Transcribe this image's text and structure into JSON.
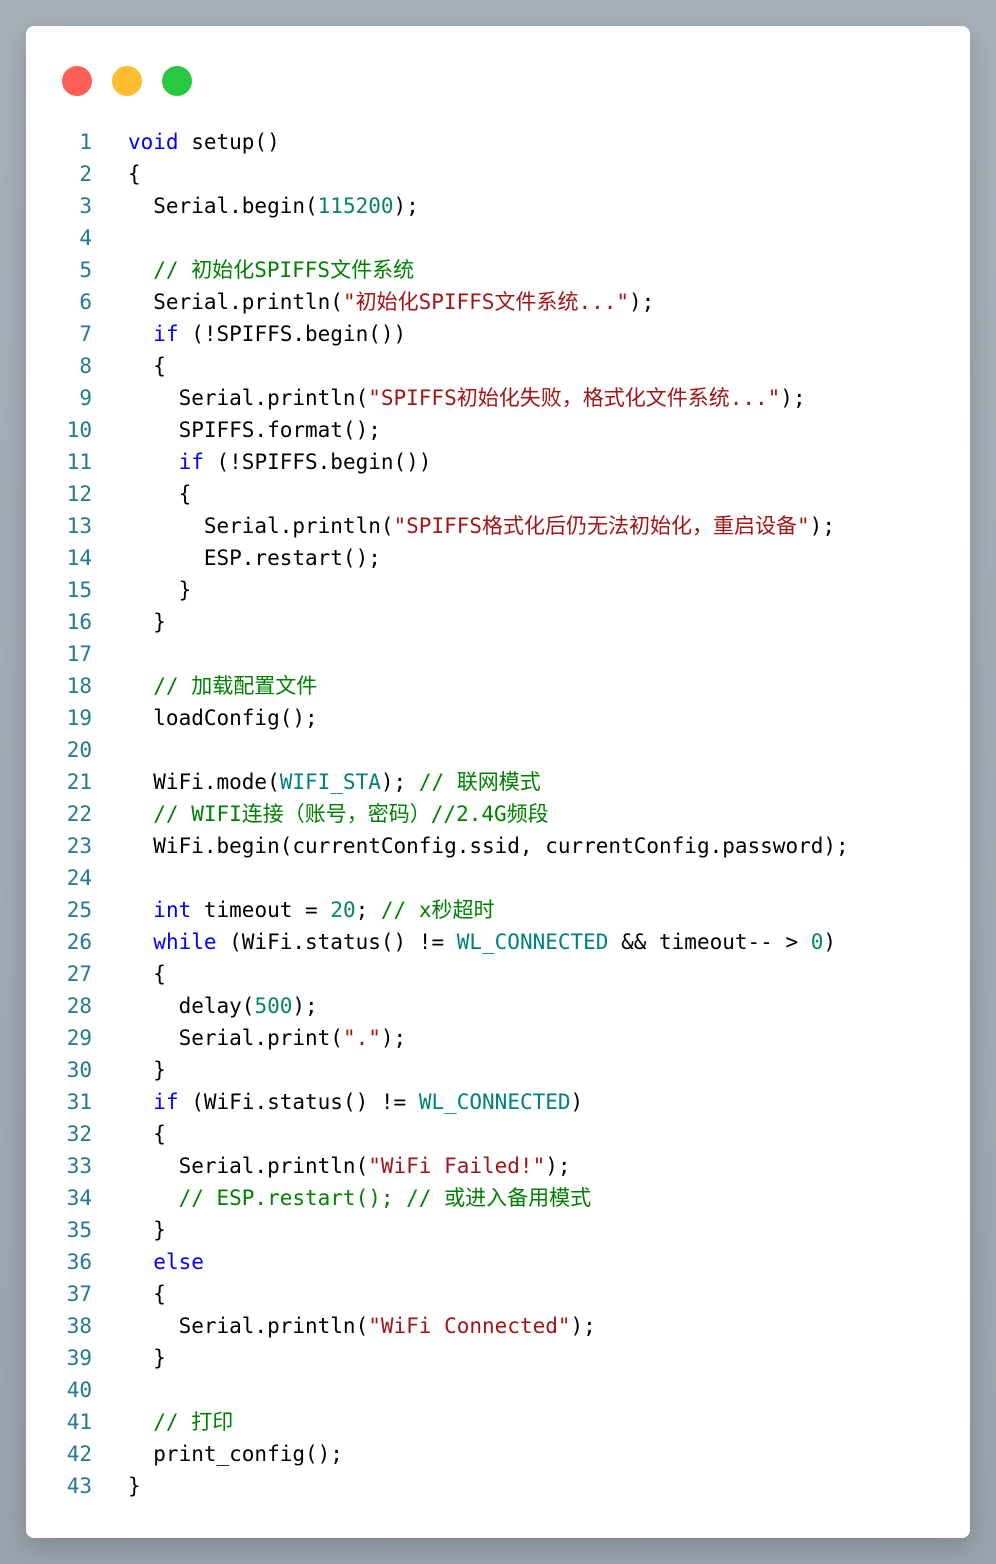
{
  "window": {
    "buttons": [
      {
        "name": "close",
        "color": "#ff5f57"
      },
      {
        "name": "minimize",
        "color": "#febc2e"
      },
      {
        "name": "zoom",
        "color": "#28c840"
      }
    ]
  },
  "colors": {
    "keyword": "#0000ff",
    "number": "#098658",
    "string": "#a31515",
    "comment": "#008000",
    "constant": "#008080",
    "line_number": "#237893"
  },
  "code": {
    "lines": [
      {
        "n": "1",
        "tokens": [
          {
            "t": "kw",
            "v": "void"
          },
          {
            "t": "plain",
            "v": " setup()"
          }
        ]
      },
      {
        "n": "2",
        "tokens": [
          {
            "t": "plain",
            "v": "{"
          }
        ]
      },
      {
        "n": "3",
        "tokens": [
          {
            "t": "plain",
            "v": "  Serial.begin("
          },
          {
            "t": "num",
            "v": "115200"
          },
          {
            "t": "plain",
            "v": ");"
          }
        ]
      },
      {
        "n": "4",
        "tokens": []
      },
      {
        "n": "5",
        "tokens": [
          {
            "t": "cmt",
            "v": "  // 初始化SPIFFS文件系统"
          }
        ]
      },
      {
        "n": "6",
        "tokens": [
          {
            "t": "plain",
            "v": "  Serial.println("
          },
          {
            "t": "str",
            "v": "\"初始化SPIFFS文件系统...\""
          },
          {
            "t": "plain",
            "v": ");"
          }
        ]
      },
      {
        "n": "7",
        "tokens": [
          {
            "t": "plain",
            "v": "  "
          },
          {
            "t": "kw",
            "v": "if"
          },
          {
            "t": "plain",
            "v": " (!SPIFFS.begin())"
          }
        ]
      },
      {
        "n": "8",
        "tokens": [
          {
            "t": "plain",
            "v": "  {"
          }
        ]
      },
      {
        "n": "9",
        "tokens": [
          {
            "t": "plain",
            "v": "    Serial.println("
          },
          {
            "t": "str",
            "v": "\"SPIFFS初始化失败，格式化文件系统...\""
          },
          {
            "t": "plain",
            "v": ");"
          }
        ]
      },
      {
        "n": "10",
        "tokens": [
          {
            "t": "plain",
            "v": "    SPIFFS.format();"
          }
        ]
      },
      {
        "n": "11",
        "tokens": [
          {
            "t": "plain",
            "v": "    "
          },
          {
            "t": "kw",
            "v": "if"
          },
          {
            "t": "plain",
            "v": " (!SPIFFS.begin())"
          }
        ]
      },
      {
        "n": "12",
        "tokens": [
          {
            "t": "plain",
            "v": "    {"
          }
        ]
      },
      {
        "n": "13",
        "tokens": [
          {
            "t": "plain",
            "v": "      Serial.println("
          },
          {
            "t": "str",
            "v": "\"SPIFFS格式化后仍无法初始化，重启设备\""
          },
          {
            "t": "plain",
            "v": ");"
          }
        ]
      },
      {
        "n": "14",
        "tokens": [
          {
            "t": "plain",
            "v": "      ESP.restart();"
          }
        ]
      },
      {
        "n": "15",
        "tokens": [
          {
            "t": "plain",
            "v": "    }"
          }
        ]
      },
      {
        "n": "16",
        "tokens": [
          {
            "t": "plain",
            "v": "  }"
          }
        ]
      },
      {
        "n": "17",
        "tokens": []
      },
      {
        "n": "18",
        "tokens": [
          {
            "t": "cmt",
            "v": "  // 加载配置文件"
          }
        ]
      },
      {
        "n": "19",
        "tokens": [
          {
            "t": "plain",
            "v": "  loadConfig();"
          }
        ]
      },
      {
        "n": "20",
        "tokens": []
      },
      {
        "n": "21",
        "tokens": [
          {
            "t": "plain",
            "v": "  WiFi.mode("
          },
          {
            "t": "const",
            "v": "WIFI_STA"
          },
          {
            "t": "plain",
            "v": "); "
          },
          {
            "t": "cmt",
            "v": "// 联网模式"
          }
        ]
      },
      {
        "n": "22",
        "tokens": [
          {
            "t": "cmt",
            "v": "  // WIFI连接（账号，密码）//2.4G频段"
          }
        ]
      },
      {
        "n": "23",
        "tokens": [
          {
            "t": "plain",
            "v": "  WiFi.begin(currentConfig.ssid, currentConfig.password);"
          }
        ]
      },
      {
        "n": "24",
        "tokens": []
      },
      {
        "n": "25",
        "tokens": [
          {
            "t": "plain",
            "v": "  "
          },
          {
            "t": "kw",
            "v": "int"
          },
          {
            "t": "plain",
            "v": " timeout = "
          },
          {
            "t": "num",
            "v": "20"
          },
          {
            "t": "plain",
            "v": "; "
          },
          {
            "t": "cmt",
            "v": "// x秒超时"
          }
        ]
      },
      {
        "n": "26",
        "tokens": [
          {
            "t": "plain",
            "v": "  "
          },
          {
            "t": "kw",
            "v": "while"
          },
          {
            "t": "plain",
            "v": " (WiFi.status() != "
          },
          {
            "t": "const",
            "v": "WL_CONNECTED"
          },
          {
            "t": "plain",
            "v": " && timeout-- > "
          },
          {
            "t": "num",
            "v": "0"
          },
          {
            "t": "plain",
            "v": ")"
          }
        ]
      },
      {
        "n": "27",
        "tokens": [
          {
            "t": "plain",
            "v": "  {"
          }
        ]
      },
      {
        "n": "28",
        "tokens": [
          {
            "t": "plain",
            "v": "    delay("
          },
          {
            "t": "num",
            "v": "500"
          },
          {
            "t": "plain",
            "v": ");"
          }
        ]
      },
      {
        "n": "29",
        "tokens": [
          {
            "t": "plain",
            "v": "    Serial.print("
          },
          {
            "t": "str",
            "v": "\".\""
          },
          {
            "t": "plain",
            "v": ");"
          }
        ]
      },
      {
        "n": "30",
        "tokens": [
          {
            "t": "plain",
            "v": "  }"
          }
        ]
      },
      {
        "n": "31",
        "tokens": [
          {
            "t": "plain",
            "v": "  "
          },
          {
            "t": "kw",
            "v": "if"
          },
          {
            "t": "plain",
            "v": " (WiFi.status() != "
          },
          {
            "t": "const",
            "v": "WL_CONNECTED"
          },
          {
            "t": "plain",
            "v": ")"
          }
        ]
      },
      {
        "n": "32",
        "tokens": [
          {
            "t": "plain",
            "v": "  {"
          }
        ]
      },
      {
        "n": "33",
        "tokens": [
          {
            "t": "plain",
            "v": "    Serial.println("
          },
          {
            "t": "str",
            "v": "\"WiFi Failed!\""
          },
          {
            "t": "plain",
            "v": ");"
          }
        ]
      },
      {
        "n": "34",
        "tokens": [
          {
            "t": "cmt",
            "v": "    // ESP.restart(); // 或进入备用模式"
          }
        ]
      },
      {
        "n": "35",
        "tokens": [
          {
            "t": "plain",
            "v": "  }"
          }
        ]
      },
      {
        "n": "36",
        "tokens": [
          {
            "t": "plain",
            "v": "  "
          },
          {
            "t": "kw",
            "v": "else"
          }
        ]
      },
      {
        "n": "37",
        "tokens": [
          {
            "t": "plain",
            "v": "  {"
          }
        ]
      },
      {
        "n": "38",
        "tokens": [
          {
            "t": "plain",
            "v": "    Serial.println("
          },
          {
            "t": "str",
            "v": "\"WiFi Connected\""
          },
          {
            "t": "plain",
            "v": ");"
          }
        ]
      },
      {
        "n": "39",
        "tokens": [
          {
            "t": "plain",
            "v": "  }"
          }
        ]
      },
      {
        "n": "40",
        "tokens": []
      },
      {
        "n": "41",
        "tokens": [
          {
            "t": "cmt",
            "v": "  // 打印"
          }
        ]
      },
      {
        "n": "42",
        "tokens": [
          {
            "t": "plain",
            "v": "  print_config();"
          }
        ]
      },
      {
        "n": "43",
        "tokens": [
          {
            "t": "plain",
            "v": "}"
          }
        ]
      }
    ]
  }
}
